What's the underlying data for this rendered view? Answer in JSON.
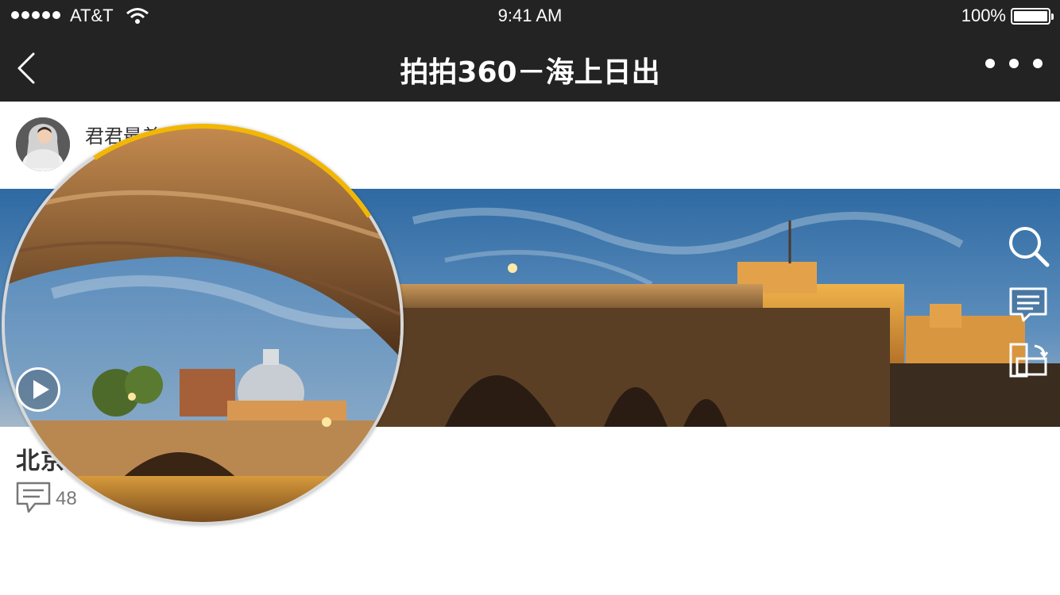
{
  "status_bar": {
    "carrier": "AT&T",
    "time": "9:41 AM",
    "battery": "100%",
    "battery_level": 1.0
  },
  "nav": {
    "title": "拍拍360－海上日出",
    "back_icon": "chevron-left-icon",
    "more_icon": "more-dots-icon"
  },
  "post": {
    "author_name": "君君最美",
    "title": "北京颐和园！！！",
    "comment_count": "48"
  },
  "tools": [
    "search-icon",
    "comment-icon",
    "rotate-screen-icon"
  ],
  "colors": {
    "bar": "#232323",
    "lens_accent": "#f2b705"
  }
}
